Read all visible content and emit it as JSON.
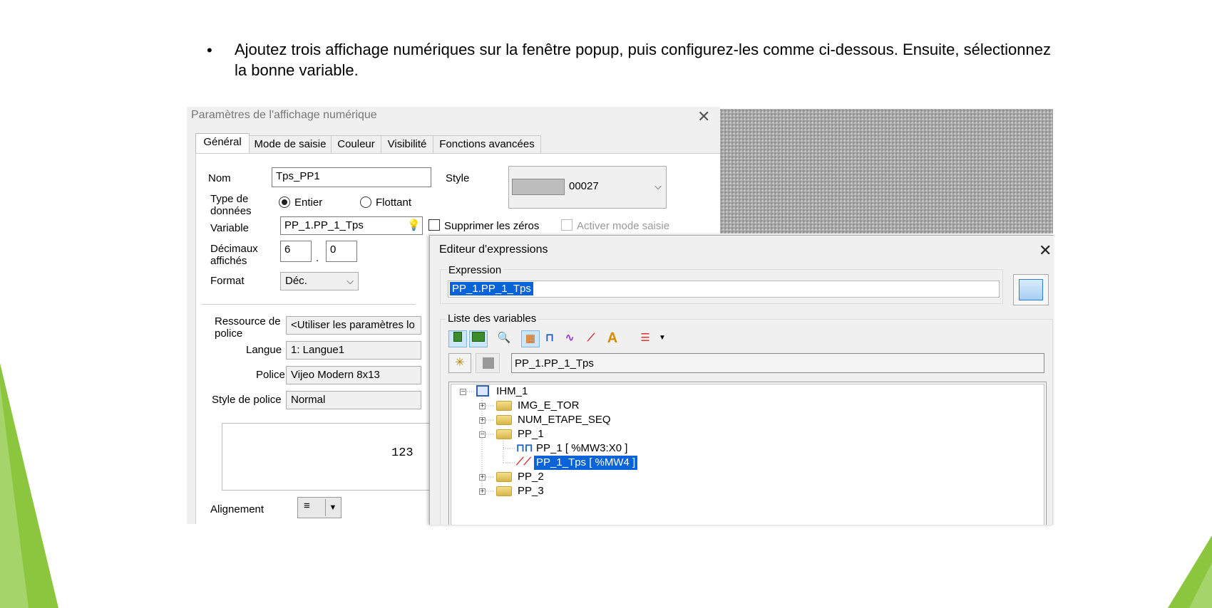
{
  "instruction": {
    "bullet": "•",
    "text": "Ajoutez trois affichage numériques sur la fenêtre popup, puis configurez-les comme ci-dessous. Ensuite, sélectionnez la bonne variable."
  },
  "dialog": {
    "title": "Paramètres de l'affichage numérique",
    "close": "✕",
    "tabs": [
      "Général",
      "Mode de saisie",
      "Couleur",
      "Visibilité",
      "Fonctions avancées"
    ],
    "nom_label": "Nom",
    "nom_value": "Tps_PP1",
    "style_label": "Style",
    "style_value": "00027",
    "type_label": "Type de données",
    "type_entier": "Entier",
    "type_flottant": "Flottant",
    "variable_label": "Variable",
    "variable_value": "PP_1.PP_1_Tps",
    "suppress_zeros": "Supprimer les zéros",
    "activer_saisie": "Activer mode saisie",
    "decimaux_label": "Décimaux affichés",
    "dec_int": "6",
    "dec_sep": ".",
    "dec_frac": "0",
    "format_label": "Format",
    "format_value": "Déc.",
    "ressource_label": "Ressource de police",
    "ressource_value": "<Utiliser les paramètres lo",
    "langue_label": "Langue",
    "langue_value": "1: Langue1",
    "police_label": "Police",
    "police_value": "Vijeo Modern 8x13",
    "style_police_label": "Style de police",
    "style_police_value": "Normal",
    "preview": "123",
    "alignement_label": "Alignement",
    "alignement_icon": "≡"
  },
  "editor": {
    "title": "Editeur d'expressions",
    "close": "✕",
    "expression_label": "Expression",
    "expression_value": "PP_1.PP_1_Tps",
    "liste_label": "Liste des variables",
    "filter_value": "PP_1.PP_1_Tps",
    "tree": {
      "root": "IHM_1",
      "n1": "IMG_E_TOR",
      "n2": "NUM_ETAPE_SEQ",
      "n3": "PP_1",
      "n3a": "PP_1 [ %MW3:X0 ]",
      "n3b": "PP_1_Tps [ %MW4 ]",
      "n4": "PP_2",
      "n5": "PP_3"
    }
  },
  "colors": {
    "selection": "#0a64d8",
    "slide_green": "#8cc63f"
  }
}
